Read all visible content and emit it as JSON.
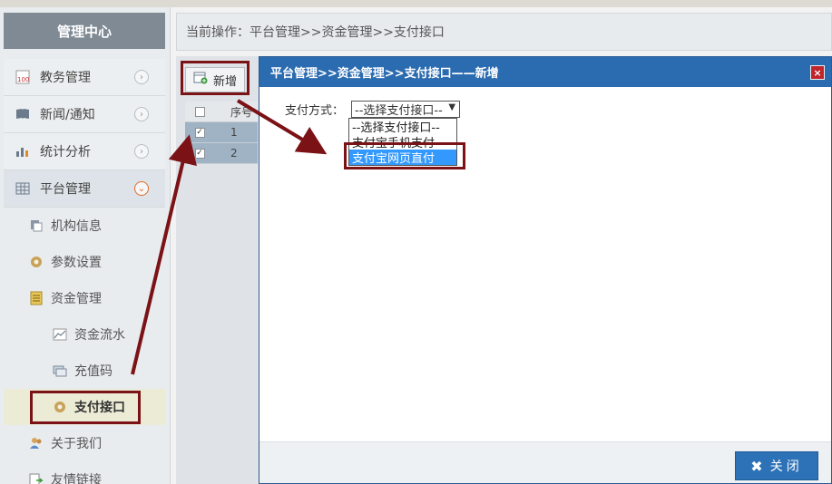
{
  "sidebar": {
    "header": "管理中心",
    "menu": [
      {
        "label": "教务管理",
        "icon": "report-icon"
      },
      {
        "label": "新闻/通知",
        "icon": "book-icon"
      },
      {
        "label": "统计分析",
        "icon": "bar-chart-icon"
      },
      {
        "label": "平台管理",
        "icon": "calendar-grid-icon",
        "expanded": true
      }
    ],
    "sub": [
      {
        "label": "机构信息",
        "icon": "org-icon"
      },
      {
        "label": "参数设置",
        "icon": "gear-icon"
      },
      {
        "label": "资金管理",
        "icon": "ledger-icon"
      }
    ],
    "subsub": [
      {
        "label": "资金流水",
        "icon": "line-chart-icon"
      },
      {
        "label": "充值码",
        "icon": "cards-icon"
      },
      {
        "label": "支付接口",
        "icon": "gear-icon",
        "selected": true
      }
    ],
    "tail": [
      {
        "label": "关于我们",
        "icon": "people-icon"
      },
      {
        "label": "友情链接",
        "icon": "link-icon"
      }
    ]
  },
  "breadcrumb": "当前操作：平台管理>>资金管理>>支付接口",
  "toolbar": {
    "add_label": "新增"
  },
  "grid": {
    "header_num": "序号",
    "rows": [
      "1",
      "2"
    ]
  },
  "dialog": {
    "title": "平台管理>>资金管理>>支付接口——新增",
    "close_x": "×",
    "field_label": "支付方式：",
    "select_value": "--选择支付接口--",
    "options": [
      "--选择支付接口--",
      "支付宝手机支付",
      "支付宝网页直付"
    ],
    "highlighted_option": 2,
    "close_label": "关闭"
  },
  "colors": {
    "accent": "#2b6bb0",
    "annotation": "#7a1216",
    "highlight": "#3399ff"
  }
}
